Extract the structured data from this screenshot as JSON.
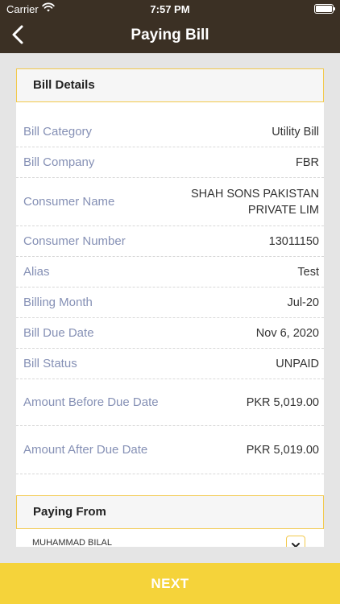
{
  "status_bar": {
    "carrier": "Carrier",
    "time": "7:57 PM"
  },
  "nav": {
    "title": "Paying Bill"
  },
  "bill_details": {
    "header": "Bill Details",
    "rows": [
      {
        "label": "Bill Category",
        "value": "Utility Bill"
      },
      {
        "label": "Bill Company",
        "value": "FBR"
      },
      {
        "label": "Consumer Name",
        "value": "SHAH SONS PAKISTAN PRIVATE LIM"
      },
      {
        "label": "Consumer Number",
        "value": "13011150"
      },
      {
        "label": "Alias",
        "value": "Test"
      },
      {
        "label": "Billing Month",
        "value": "Jul-20"
      },
      {
        "label": "Bill Due Date",
        "value": "Nov 6, 2020"
      },
      {
        "label": "Bill Status",
        "value": "UNPAID"
      },
      {
        "label": "Amount Before Due Date",
        "value": "PKR 5,019.00"
      },
      {
        "label": "Amount After Due Date",
        "value": "PKR 5,019.00"
      }
    ]
  },
  "paying_from": {
    "header": "Paying From",
    "account_name": "MUHAMMAD BILAL"
  },
  "footer": {
    "next_label": "NEXT"
  },
  "colors": {
    "nav_bg": "#3b3024",
    "accent": "#f5d33a",
    "label": "#8590b5"
  }
}
